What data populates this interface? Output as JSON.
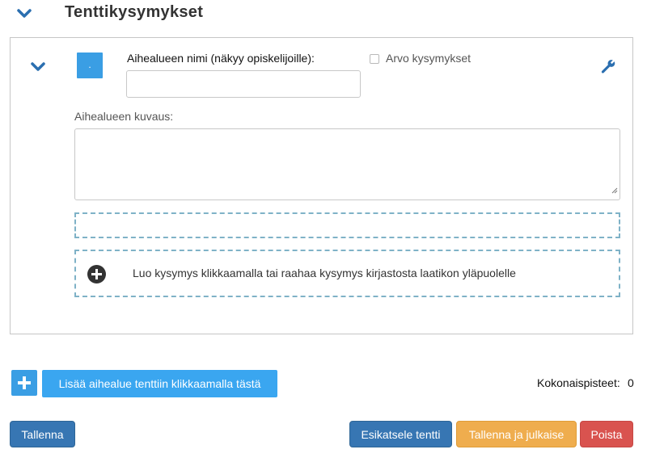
{
  "colors": {
    "primary": "#3776b3",
    "accent_blue": "#3aa6f0",
    "warning": "#efad4e",
    "danger": "#d9534f",
    "dashed_border": "#7fb2c7"
  },
  "header": {
    "title": "Tenttikysymykset",
    "toggle_icon": "chevron-down-icon"
  },
  "topic": {
    "collapse_icon": "chevron-down-icon",
    "square_button_text": ".",
    "name_label": "Aihealueen nimi (näkyy opiskelijoille):",
    "name_value": "",
    "name_placeholder": "",
    "randomize_label": "Arvo kysymykset",
    "randomize_checked": false,
    "settings_icon": "wrench-icon",
    "description_label": "Aihealueen kuvaus:",
    "description_value": "",
    "create_question_icon": "plus-circle-icon",
    "create_question_text": "Luo kysymys klikkaamalla tai raahaa kysymys kirjastosta laatikon yläpuolelle"
  },
  "add_topic": {
    "icon": "plus-icon",
    "button_label": "Lisää aihealue tenttiin klikkaamalla tästä"
  },
  "total_points": {
    "label": "Kokonaispisteet:",
    "value": "0"
  },
  "actions": {
    "save": "Tallenna",
    "preview": "Esikatsele tentti",
    "save_publish": "Tallenna ja julkaise",
    "delete": "Poista"
  }
}
